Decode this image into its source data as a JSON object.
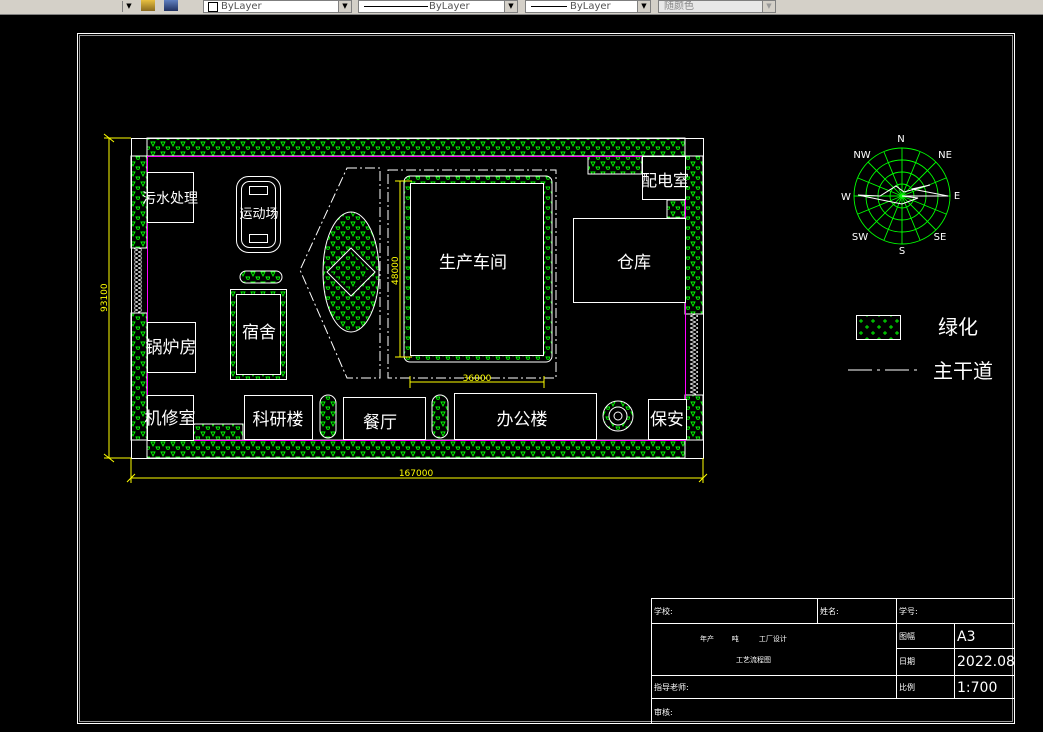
{
  "toolbar": {
    "layer_label": "ByLayer",
    "linetype_label": "ByLayer",
    "lineweight_label": "ByLayer",
    "color_label": "随颜色"
  },
  "site": {
    "buildings": {
      "sewage": "污水处理",
      "sports": "运动场",
      "boiler": "锅炉房",
      "dorm": "宿舍",
      "repair": "机修室",
      "research": "科研楼",
      "canteen": "餐厅",
      "office": "办公楼",
      "security": "保安",
      "workshop": "生产车间",
      "warehouse": "仓库",
      "power": "配电室"
    },
    "dimensions": {
      "total_width": "167000",
      "total_height": "93100",
      "workshop_width": "36000",
      "workshop_height": "48000"
    }
  },
  "compass": {
    "n": "N",
    "ne": "NE",
    "e": "E",
    "se": "SE",
    "s": "S",
    "sw": "SW",
    "w": "W",
    "nw": "NW"
  },
  "legend": {
    "green_label": "绿化",
    "road_label": "主干道"
  },
  "title_block": {
    "school": "学校:",
    "name": "姓名:",
    "student_id": "学号:",
    "project_line1": "年产        吨         工厂设计",
    "project_line2": "工艺流程图",
    "sheet_label": "图幅",
    "sheet_value": "A3",
    "date_label": "日期",
    "date_value": "2022.08",
    "scale_label": "比例",
    "scale_value": "1:700",
    "advisor": "指导老师:",
    "reviewer": "审核:"
  }
}
